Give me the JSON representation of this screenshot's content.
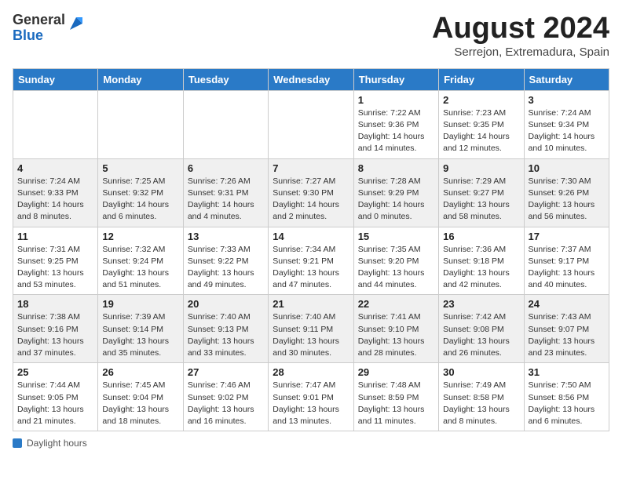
{
  "header": {
    "logo_general": "General",
    "logo_blue": "Blue",
    "month_title": "August 2024",
    "subtitle": "Serrejon, Extremadura, Spain"
  },
  "calendar": {
    "days_of_week": [
      "Sunday",
      "Monday",
      "Tuesday",
      "Wednesday",
      "Thursday",
      "Friday",
      "Saturday"
    ],
    "weeks": [
      [
        {
          "day": "",
          "info": ""
        },
        {
          "day": "",
          "info": ""
        },
        {
          "day": "",
          "info": ""
        },
        {
          "day": "",
          "info": ""
        },
        {
          "day": "1",
          "info": "Sunrise: 7:22 AM\nSunset: 9:36 PM\nDaylight: 14 hours\nand 14 minutes."
        },
        {
          "day": "2",
          "info": "Sunrise: 7:23 AM\nSunset: 9:35 PM\nDaylight: 14 hours\nand 12 minutes."
        },
        {
          "day": "3",
          "info": "Sunrise: 7:24 AM\nSunset: 9:34 PM\nDaylight: 14 hours\nand 10 minutes."
        }
      ],
      [
        {
          "day": "4",
          "info": "Sunrise: 7:24 AM\nSunset: 9:33 PM\nDaylight: 14 hours\nand 8 minutes."
        },
        {
          "day": "5",
          "info": "Sunrise: 7:25 AM\nSunset: 9:32 PM\nDaylight: 14 hours\nand 6 minutes."
        },
        {
          "day": "6",
          "info": "Sunrise: 7:26 AM\nSunset: 9:31 PM\nDaylight: 14 hours\nand 4 minutes."
        },
        {
          "day": "7",
          "info": "Sunrise: 7:27 AM\nSunset: 9:30 PM\nDaylight: 14 hours\nand 2 minutes."
        },
        {
          "day": "8",
          "info": "Sunrise: 7:28 AM\nSunset: 9:29 PM\nDaylight: 14 hours\nand 0 minutes."
        },
        {
          "day": "9",
          "info": "Sunrise: 7:29 AM\nSunset: 9:27 PM\nDaylight: 13 hours\nand 58 minutes."
        },
        {
          "day": "10",
          "info": "Sunrise: 7:30 AM\nSunset: 9:26 PM\nDaylight: 13 hours\nand 56 minutes."
        }
      ],
      [
        {
          "day": "11",
          "info": "Sunrise: 7:31 AM\nSunset: 9:25 PM\nDaylight: 13 hours\nand 53 minutes."
        },
        {
          "day": "12",
          "info": "Sunrise: 7:32 AM\nSunset: 9:24 PM\nDaylight: 13 hours\nand 51 minutes."
        },
        {
          "day": "13",
          "info": "Sunrise: 7:33 AM\nSunset: 9:22 PM\nDaylight: 13 hours\nand 49 minutes."
        },
        {
          "day": "14",
          "info": "Sunrise: 7:34 AM\nSunset: 9:21 PM\nDaylight: 13 hours\nand 47 minutes."
        },
        {
          "day": "15",
          "info": "Sunrise: 7:35 AM\nSunset: 9:20 PM\nDaylight: 13 hours\nand 44 minutes."
        },
        {
          "day": "16",
          "info": "Sunrise: 7:36 AM\nSunset: 9:18 PM\nDaylight: 13 hours\nand 42 minutes."
        },
        {
          "day": "17",
          "info": "Sunrise: 7:37 AM\nSunset: 9:17 PM\nDaylight: 13 hours\nand 40 minutes."
        }
      ],
      [
        {
          "day": "18",
          "info": "Sunrise: 7:38 AM\nSunset: 9:16 PM\nDaylight: 13 hours\nand 37 minutes."
        },
        {
          "day": "19",
          "info": "Sunrise: 7:39 AM\nSunset: 9:14 PM\nDaylight: 13 hours\nand 35 minutes."
        },
        {
          "day": "20",
          "info": "Sunrise: 7:40 AM\nSunset: 9:13 PM\nDaylight: 13 hours\nand 33 minutes."
        },
        {
          "day": "21",
          "info": "Sunrise: 7:40 AM\nSunset: 9:11 PM\nDaylight: 13 hours\nand 30 minutes."
        },
        {
          "day": "22",
          "info": "Sunrise: 7:41 AM\nSunset: 9:10 PM\nDaylight: 13 hours\nand 28 minutes."
        },
        {
          "day": "23",
          "info": "Sunrise: 7:42 AM\nSunset: 9:08 PM\nDaylight: 13 hours\nand 26 minutes."
        },
        {
          "day": "24",
          "info": "Sunrise: 7:43 AM\nSunset: 9:07 PM\nDaylight: 13 hours\nand 23 minutes."
        }
      ],
      [
        {
          "day": "25",
          "info": "Sunrise: 7:44 AM\nSunset: 9:05 PM\nDaylight: 13 hours\nand 21 minutes."
        },
        {
          "day": "26",
          "info": "Sunrise: 7:45 AM\nSunset: 9:04 PM\nDaylight: 13 hours\nand 18 minutes."
        },
        {
          "day": "27",
          "info": "Sunrise: 7:46 AM\nSunset: 9:02 PM\nDaylight: 13 hours\nand 16 minutes."
        },
        {
          "day": "28",
          "info": "Sunrise: 7:47 AM\nSunset: 9:01 PM\nDaylight: 13 hours\nand 13 minutes."
        },
        {
          "day": "29",
          "info": "Sunrise: 7:48 AM\nSunset: 8:59 PM\nDaylight: 13 hours\nand 11 minutes."
        },
        {
          "day": "30",
          "info": "Sunrise: 7:49 AM\nSunset: 8:58 PM\nDaylight: 13 hours\nand 8 minutes."
        },
        {
          "day": "31",
          "info": "Sunrise: 7:50 AM\nSunset: 8:56 PM\nDaylight: 13 hours\nand 6 minutes."
        }
      ]
    ]
  },
  "footer": {
    "note": "Daylight hours"
  }
}
